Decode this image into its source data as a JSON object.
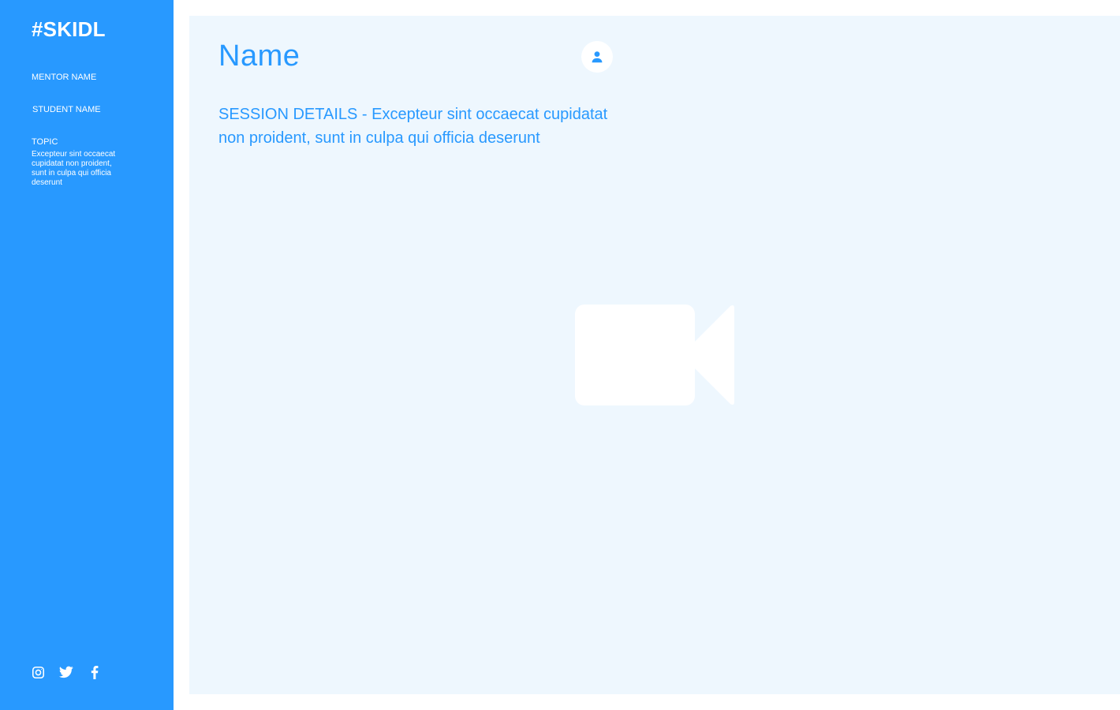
{
  "sidebar": {
    "logo": "#SKIDL",
    "mentor_label": "MENTOR NAME",
    "student_label": "STUDENT NAME",
    "topic_label": "TOPIC",
    "topic_description": "Excepteur sint occaecat cupidatat non proident, sunt in culpa qui officia deserunt",
    "social": [
      {
        "icon": "instagram-icon"
      },
      {
        "icon": "twitter-icon"
      },
      {
        "icon": "facebook-icon"
      }
    ]
  },
  "main": {
    "title": "Name",
    "session_details": "SESSION DETAILS - Excepteur sint occaecat cupidatat non proident, sunt in culpa qui officia deserunt",
    "avatar_icon": "user-icon",
    "video_icon": "video-camera-icon"
  },
  "colors": {
    "brand": "#2899ff",
    "panel": "#eef7fe",
    "white": "#ffffff"
  }
}
